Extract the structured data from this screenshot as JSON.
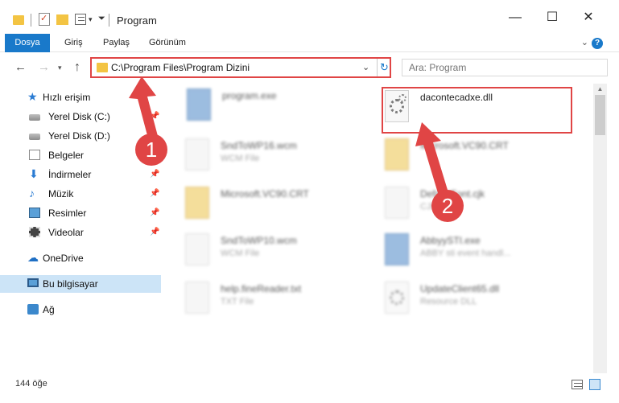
{
  "window": {
    "title": "Program",
    "minimize_icon": "minimize-icon",
    "maximize_icon": "maximize-icon",
    "close_icon": "close-icon"
  },
  "ribbon": {
    "tabs": [
      "Dosya",
      "Giriş",
      "Paylaş",
      "Görünüm"
    ],
    "help_label": "?"
  },
  "address": {
    "path": "C:\\Program Files\\Program Dizini",
    "search_placeholder": "Ara: Program"
  },
  "sidebar": {
    "items": [
      {
        "label": "Hızlı erişim",
        "icon": "star-icon"
      },
      {
        "label": "Yerel Disk (C:)",
        "icon": "disk-icon"
      },
      {
        "label": "Yerel Disk (D:)",
        "icon": "disk-icon"
      },
      {
        "label": "Belgeler",
        "icon": "documents-icon"
      },
      {
        "label": "İndirmeler",
        "icon": "downloads-icon"
      },
      {
        "label": "Müzik",
        "icon": "music-icon"
      },
      {
        "label": "Resimler",
        "icon": "pictures-icon"
      },
      {
        "label": "Videolar",
        "icon": "videos-icon"
      },
      {
        "label": "OneDrive",
        "icon": "cloud-icon"
      },
      {
        "label": "Bu bilgisayar",
        "icon": "computer-icon"
      },
      {
        "label": "Ağ",
        "icon": "network-icon"
      }
    ]
  },
  "files": [
    {
      "name": "program.exe",
      "type": ""
    },
    {
      "name": "dacontecadxe.dll",
      "type": ""
    },
    {
      "name": "SndToWP16.wcm",
      "type": "WCM File"
    },
    {
      "name": "Microsoft.VC90.CRT",
      "type": ""
    },
    {
      "name": "Microsoft.VC90.CRT",
      "type": ""
    },
    {
      "name": "DefaultFont.cjk",
      "type": "CJK File"
    },
    {
      "name": "SndToWP10.wcm",
      "type": "WCM File"
    },
    {
      "name": "AbbyySTI.exe",
      "type": "ABBY sti event handl..."
    },
    {
      "name": "help.fineReader.txt",
      "type": "TXT File"
    },
    {
      "name": "UpdateClient65.dll",
      "type": "Resource DLL"
    }
  ],
  "status": {
    "item_count": "144 öğe"
  },
  "annotations": {
    "step1": "1",
    "step2": "2",
    "color": "#e04545"
  }
}
